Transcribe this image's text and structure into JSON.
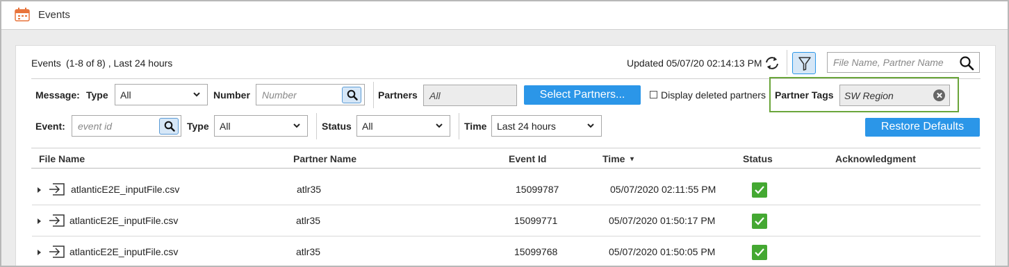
{
  "window": {
    "title": "Events"
  },
  "summary": {
    "label": "Events",
    "range": "(1-8 of 8) , Last 24 hours",
    "updated": "Updated 05/07/20 02:14:13 PM"
  },
  "search": {
    "placeholder": "File Name, Partner Name"
  },
  "filters": {
    "message_label": "Message:",
    "type_label": "Type",
    "message_type_value": "All",
    "number_label": "Number",
    "number_placeholder": "Number",
    "partners_label": "Partners",
    "partners_value": "All",
    "select_partners_label": "Select Partners...",
    "display_deleted_label": "Display deleted partners",
    "partner_tags_label": "Partner Tags",
    "partner_tags_value": "SW Region",
    "event_label": "Event:",
    "event_placeholder": "event id",
    "event_type_label": "Type",
    "event_type_value": "All",
    "status_label": "Status",
    "status_value": "All",
    "time_label": "Time",
    "time_value": "Last 24 hours",
    "restore_defaults_label": "Restore Defaults"
  },
  "table": {
    "columns": [
      "File Name",
      "Partner Name",
      "Event Id",
      "Time",
      "Status",
      "Acknowledgment"
    ],
    "sort_indicator": "▾",
    "rows": [
      {
        "file": "atlanticE2E_inputFile.csv",
        "partner": "atlr35",
        "event_id": "15099787",
        "time": "05/07/2020 02:11:55 PM",
        "status": "success"
      },
      {
        "file": "atlanticE2E_inputFile.csv",
        "partner": "atlr35",
        "event_id": "15099771",
        "time": "05/07/2020 01:50:17 PM",
        "status": "success"
      },
      {
        "file": "atlanticE2E_inputFile.csv",
        "partner": "atlr35",
        "event_id": "15099768",
        "time": "05/07/2020 01:50:05 PM",
        "status": "success"
      }
    ]
  },
  "colors": {
    "accent": "#2b96e8",
    "link": "#2a6fc9",
    "status_ok": "#44a832",
    "highlight_border": "#6aa53a"
  },
  "icons": {
    "app": "calendar-icon",
    "refresh": "refresh-icon",
    "filter": "funnel-icon",
    "search": "search-icon",
    "row_type": "inbound-arrow-icon",
    "status": "checkmark-icon"
  }
}
